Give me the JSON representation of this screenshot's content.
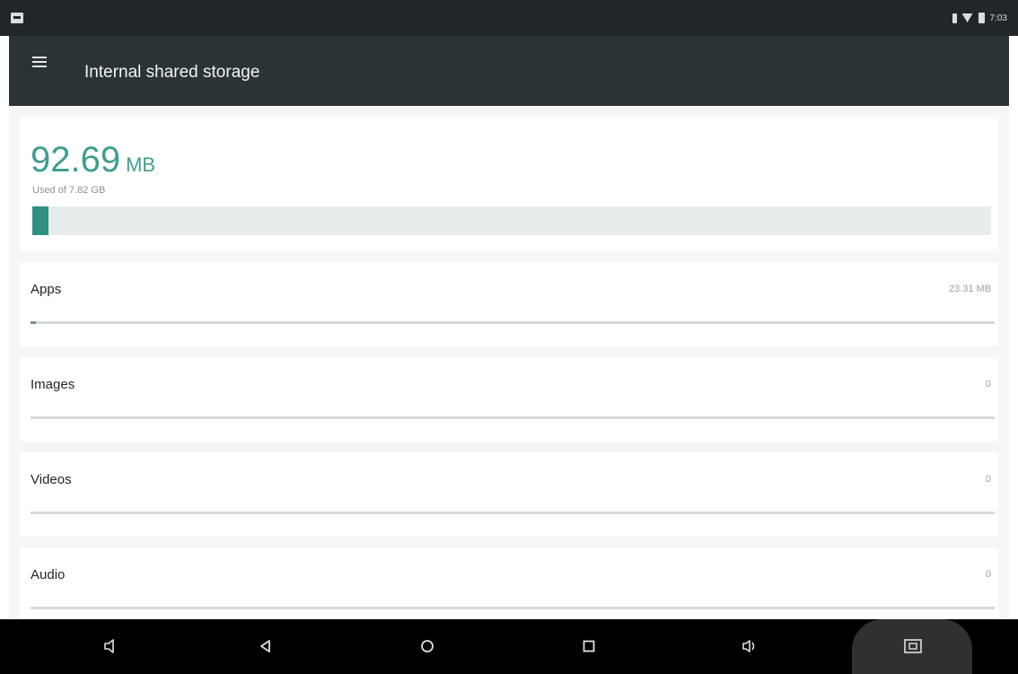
{
  "status_bar": {
    "time": "7:03"
  },
  "toolbar": {
    "title": "Internal shared storage",
    "menu_icon": "hamburger-menu-icon"
  },
  "storage": {
    "used_value": "92.69",
    "used_unit": "MB",
    "used_caption": "Used of 7.82 GB",
    "used_fraction": 0.016
  },
  "categories": [
    {
      "label": "Apps",
      "size": "23.31 MB",
      "fraction": 0.004
    },
    {
      "label": "Images",
      "size": "0",
      "fraction": 0
    },
    {
      "label": "Videos",
      "size": "0",
      "fraction": 0
    },
    {
      "label": "Audio",
      "size": "0",
      "fraction": 0
    }
  ],
  "nav_bar": {
    "buttons": [
      "volume-down-icon",
      "back-icon",
      "home-icon",
      "recents-icon",
      "volume-up-icon",
      "screenshot-icon"
    ],
    "highlight_color": "#303030"
  },
  "colors": {
    "accent": "#3f9e8f",
    "toolbar": "#2c3337",
    "status_bar": "#20262a"
  }
}
